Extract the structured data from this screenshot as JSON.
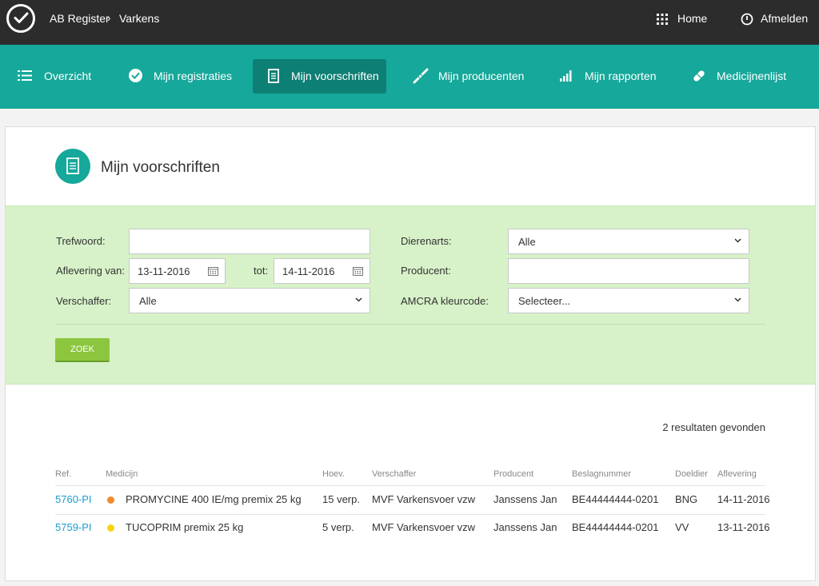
{
  "header": {
    "breadcrumb": [
      "AB Register",
      "Varkens"
    ],
    "breadcrumb_sep": "›",
    "home_label": "Home",
    "logout_label": "Afmelden"
  },
  "nav": {
    "items": [
      {
        "label": "Overzicht",
        "icon": "list-icon"
      },
      {
        "label": "Mijn registraties",
        "icon": "check-circle-icon"
      },
      {
        "label": "Mijn voorschriften",
        "icon": "document-icon",
        "active": true
      },
      {
        "label": "Mijn producenten",
        "icon": "syringe-icon"
      },
      {
        "label": "Mijn rapporten",
        "icon": "bar-chart-icon"
      },
      {
        "label": "Medicijnenlijst",
        "icon": "pill-icon"
      }
    ]
  },
  "page": {
    "title": "Mijn voorschriften"
  },
  "filters": {
    "trefwoord_label": "Trefwoord:",
    "trefwoord_value": "",
    "aflevering_label": "Aflevering van:",
    "aflevering_van": "13-11-2016",
    "tot_label": "tot:",
    "aflevering_tot": "14-11-2016",
    "verschaffer_label": "Verschaffer:",
    "verschaffer_value": "Alle",
    "dierenarts_label": "Dierenarts:",
    "dierenarts_value": "Alle",
    "producent_label": "Producent:",
    "producent_value": "",
    "amcra_label": "AMCRA kleurcode:",
    "amcra_value": "Selecteer...",
    "search_button": "ZOEK"
  },
  "results": {
    "count_text": "2 resultaten gevonden",
    "columns": [
      "Ref.",
      "Medicijn",
      "Hoev.",
      "Verschaffer",
      "Producent",
      "Beslagnummer",
      "Doeldier",
      "Aflevering"
    ],
    "rows": [
      {
        "ref": "5760-PI",
        "dot_color": "#f0892e",
        "medicijn": "PROMYCINE 400 IE/mg premix 25 kg",
        "hoev": "15 verp.",
        "verschaffer": "MVF Varkensvoer vzw",
        "producent": "Janssens Jan",
        "beslagnummer": "BE44444444-0201",
        "doeldier": "BNG",
        "aflevering": "14-11-2016"
      },
      {
        "ref": "5759-PI",
        "dot_color": "#f5d40f",
        "medicijn": "TUCOPRIM premix 25 kg",
        "hoev": "5 verp.",
        "verschaffer": "MVF Varkensvoer vzw",
        "producent": "Janssens Jan",
        "beslagnummer": "BE44444444-0201",
        "doeldier": "VV",
        "aflevering": "13-11-2016"
      }
    ]
  },
  "colors": {
    "topbar": "#2c2c2c",
    "navbar": "#16a89a",
    "nav_active": "#0e7f74",
    "filter_bg": "#d7f2c8",
    "button": "#8cc63f",
    "link": "#1a9dd0"
  }
}
